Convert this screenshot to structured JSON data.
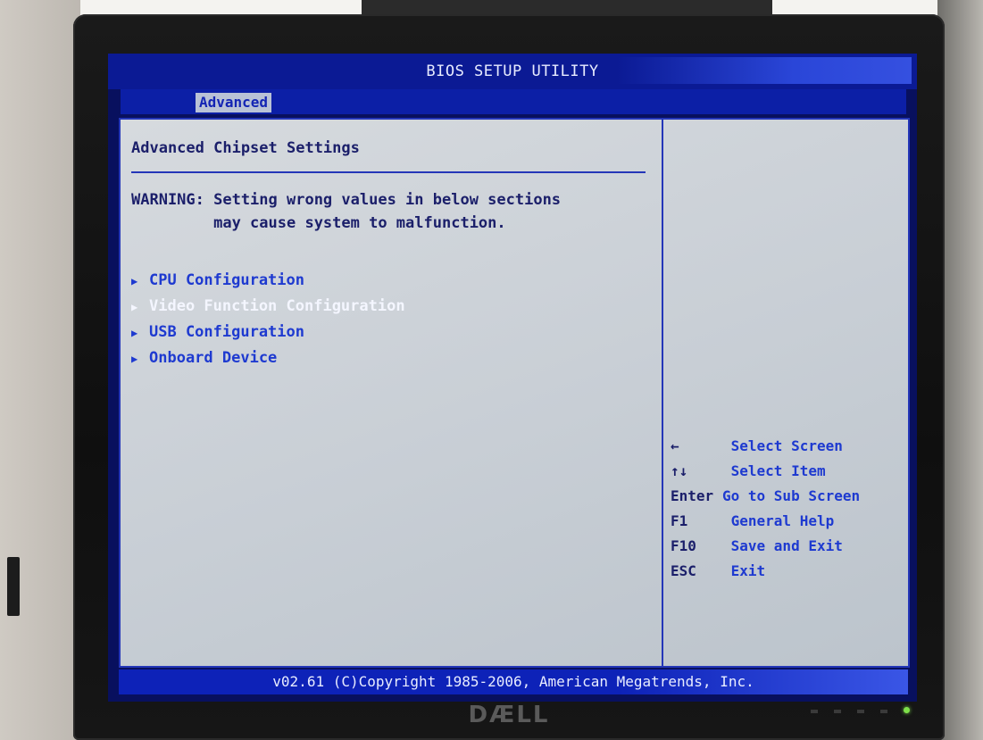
{
  "bios": {
    "title": "BIOS SETUP UTILITY",
    "tabs": [
      {
        "label": "Advanced",
        "active": true
      }
    ],
    "section_title": "Advanced Chipset Settings",
    "warning": {
      "line1": "WARNING: Setting wrong values in below sections",
      "line2": "         may cause system to malfunction."
    },
    "menu_items": [
      {
        "label": "CPU Configuration",
        "selected": false
      },
      {
        "label": "Video Function Configuration",
        "selected": true
      },
      {
        "label": "USB Configuration",
        "selected": false
      },
      {
        "label": "Onboard Device",
        "selected": false
      }
    ],
    "help": [
      {
        "key": "←",
        "desc": "  Select Screen"
      },
      {
        "key": "↑↓",
        "desc": "  Select Item"
      },
      {
        "key": "Enter",
        "desc": "Go to Sub Screen"
      },
      {
        "key": "F1",
        "desc": " General Help"
      },
      {
        "key": "F10",
        "desc": " Save and Exit"
      },
      {
        "key": "ESC",
        "desc": " Exit"
      }
    ],
    "footer": "v02.61 (C)Copyright 1985-2006, American Megatrends, Inc."
  },
  "monitor": {
    "brand": "DÆLL"
  },
  "colors": {
    "title_bar": "#0b1a94",
    "panel_bg": "#c9cfd6",
    "menu_text": "#1e3ad0",
    "selected_text": "#f4f6ff",
    "footer_bg": "#0d22b8"
  }
}
